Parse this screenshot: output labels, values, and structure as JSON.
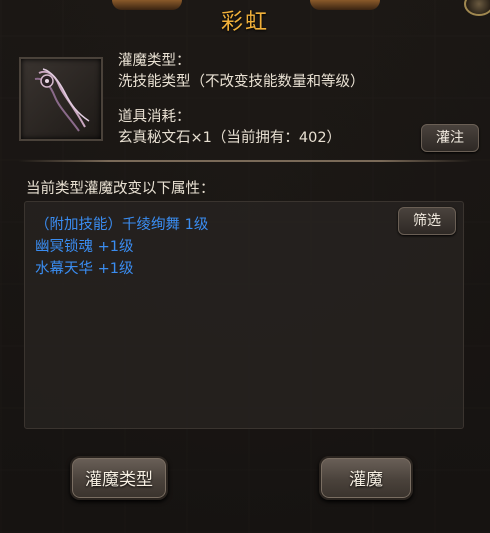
{
  "window": {
    "title": "彩虹"
  },
  "item": {
    "type_label": "灌魔类型：",
    "type_value": "洗技能类型（不改变技能数量和等级）",
    "cost_label": "道具消耗：",
    "cost_value": "玄真秘文石×1（当前拥有：402）"
  },
  "buttons": {
    "inject_small": "灌注",
    "filter": "筛选",
    "enchant_type": "灌魔类型",
    "enchant": "灌魔"
  },
  "attributes": {
    "header": "当前类型灌魔改变以下属性：",
    "lines": [
      "（附加技能）千绫绚舞 1级",
      "幽冥锁魂 +1级",
      "水幕天华 +1级"
    ]
  },
  "colors": {
    "title": "#f0b03a",
    "attribute_text": "#3a8cf0"
  }
}
